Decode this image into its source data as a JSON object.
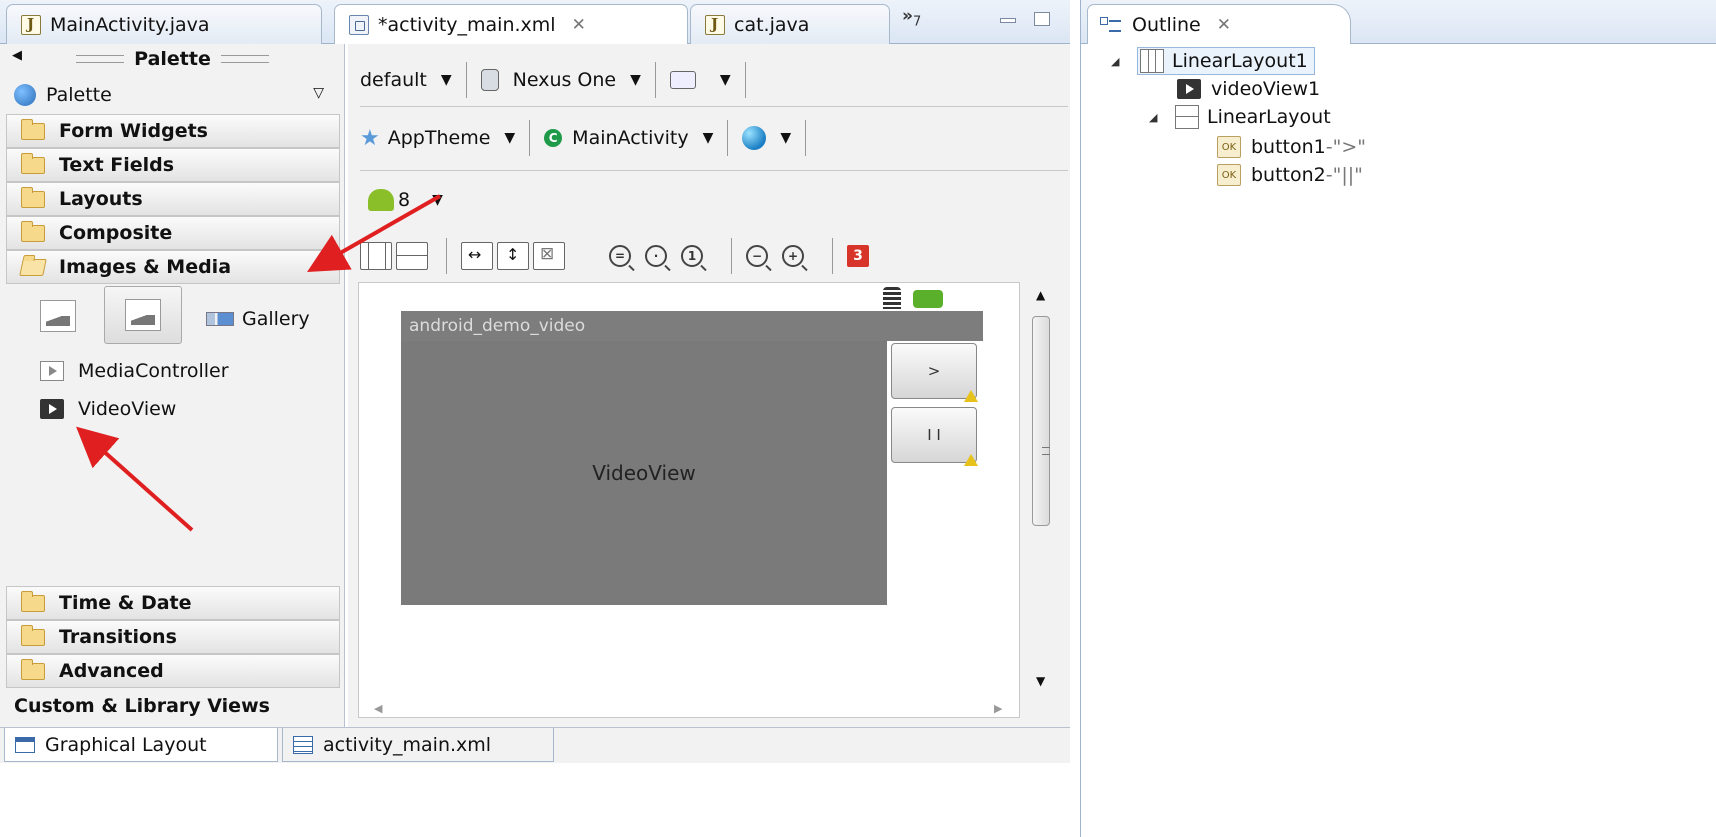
{
  "editor_tabs": [
    {
      "label": "MainActivity.java",
      "icon": "java-file-icon"
    },
    {
      "label": "*activity_main.xml",
      "icon": "xml-file-icon",
      "active": true
    },
    {
      "label": "cat.java",
      "icon": "java-file-icon"
    }
  ],
  "tab_overflow": {
    "glyph": "»",
    "count": "7"
  },
  "outline": {
    "title": "Outline",
    "tree": [
      {
        "label": "LinearLayout1",
        "icon": "vertical-linearlayout-icon"
      },
      {
        "label": "videoView1",
        "icon": "videoview-icon"
      },
      {
        "label": "LinearLayout",
        "icon": "horizontal-linearlayout-icon"
      },
      {
        "label": "button1",
        "detail": "\">\"",
        "icon": "button-icon"
      },
      {
        "label": "button2",
        "detail": "\"||\"",
        "icon": "button-icon"
      }
    ],
    "separator": " - "
  },
  "palette": {
    "title": "Palette",
    "dropdown_label": "Palette",
    "categories_top": [
      "Form Widgets",
      "Text Fields",
      "Layouts",
      "Composite",
      "Images & Media"
    ],
    "categories_bottom": [
      "Time & Date",
      "Transitions",
      "Advanced"
    ],
    "custom_views": "Custom & Library Views",
    "media_items": {
      "gallery": "Gallery",
      "media_controller": "MediaController",
      "video_view": "VideoView"
    }
  },
  "toolbar": {
    "config": "default",
    "device": "Nexus One",
    "theme": "AppTheme",
    "activity": "MainActivity",
    "api_level": "8",
    "error_count": "3"
  },
  "canvas": {
    "app_title": "android_demo_video",
    "video_view_label": "VideoView",
    "button1_label": ">",
    "button2_label": "I I"
  },
  "bottom_tabs": {
    "graphical": "Graphical Layout",
    "xml": "activity_main.xml"
  },
  "colors": {
    "annotation_arrow": "#e02020",
    "video_bg": "#7a7a7a"
  }
}
